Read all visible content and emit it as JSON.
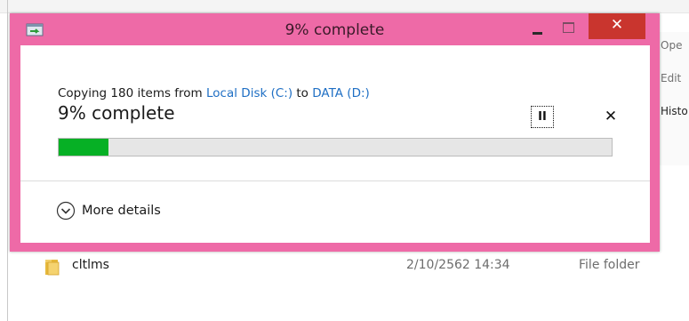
{
  "dialog": {
    "title": "9% complete",
    "close_symbol": "✕",
    "copy_prefix": "Copying 180 items from ",
    "source": "Local Disk (C:)",
    "copy_to": " to ",
    "destination": "DATA (D:)",
    "percent_text": "9% complete",
    "progress": 0.09,
    "pause_symbol": "II",
    "cancel_symbol": "✕",
    "more_details": "More details",
    "colors": {
      "frame": "#ee6aa7",
      "close": "#c9352e",
      "progress": "#06b025",
      "link": "#1f6fc4"
    },
    "icons": [
      "copy-window-icon",
      "minimize-icon",
      "maximize-icon",
      "close-icon",
      "pause-icon",
      "cancel-icon",
      "chevron-down-circle-icon"
    ]
  },
  "explorer": {
    "ribbon": [
      "Ope",
      "Edit",
      "Histo"
    ],
    "file": {
      "name": "cltlms",
      "date": "2/10/2562 14:34",
      "type": "File folder",
      "icon": "folder-icon"
    }
  }
}
